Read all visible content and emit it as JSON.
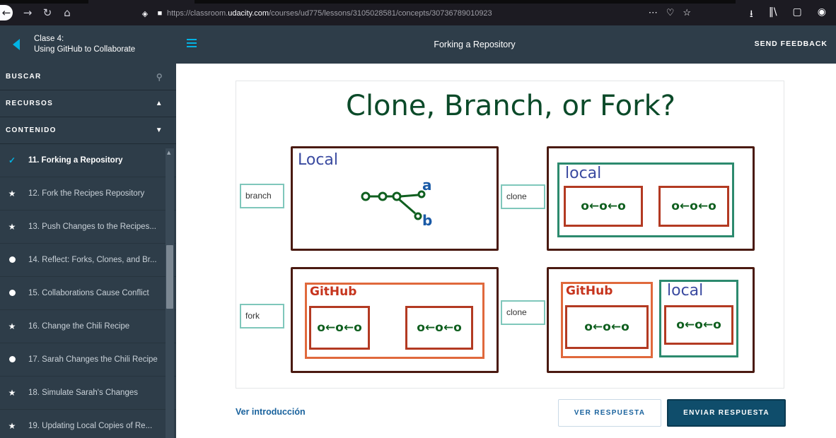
{
  "browser": {
    "url_prefix": "https://classroom.",
    "url_domain": "udacity.com",
    "url_path": "/courses/ud775/lessons/3105028581/concepts/30736789010923",
    "more_icon": "⋯"
  },
  "header": {
    "lesson_number": "Clase 4:",
    "lesson_title": "Using GitHub to Collaborate",
    "page_title": "Forking a Repository",
    "feedback": "SEND FEEDBACK"
  },
  "sidebar": {
    "search": "BUSCAR",
    "resources": "RECURSOS",
    "contents": "CONTENIDO",
    "items": [
      {
        "label": "11. Forking a Repository",
        "status": "check"
      },
      {
        "label": "12. Fork the Recipes Repository",
        "status": "star"
      },
      {
        "label": "13. Push Changes to the Recipes...",
        "status": "star"
      },
      {
        "label": "14. Reflect: Forks, Clones, and Br...",
        "status": "dot"
      },
      {
        "label": "15. Collaborations Cause Conflict",
        "status": "dot"
      },
      {
        "label": "16. Change the Chili Recipe",
        "status": "star"
      },
      {
        "label": "17. Sarah Changes the Chili Recipe",
        "status": "dot"
      },
      {
        "label": "18. Simulate Sarah's Changes",
        "status": "star"
      },
      {
        "label": "19. Updating Local Copies of Re...",
        "status": "star"
      }
    ]
  },
  "slide": {
    "title": "Clone, Branch, or Fork?",
    "labels": {
      "branch": "branch",
      "clone_top": "clone",
      "fork": "fork",
      "clone_bottom": "clone"
    },
    "local": "Local",
    "local_lower": "local",
    "github": "GitHub",
    "repo_commits": "o←o←o",
    "branch_a": "a",
    "branch_b": "b"
  },
  "actions": {
    "intro": "Ver introducción",
    "see_answer": "VER RESPUESTA",
    "submit": "ENVIAR RESPUESTA"
  }
}
